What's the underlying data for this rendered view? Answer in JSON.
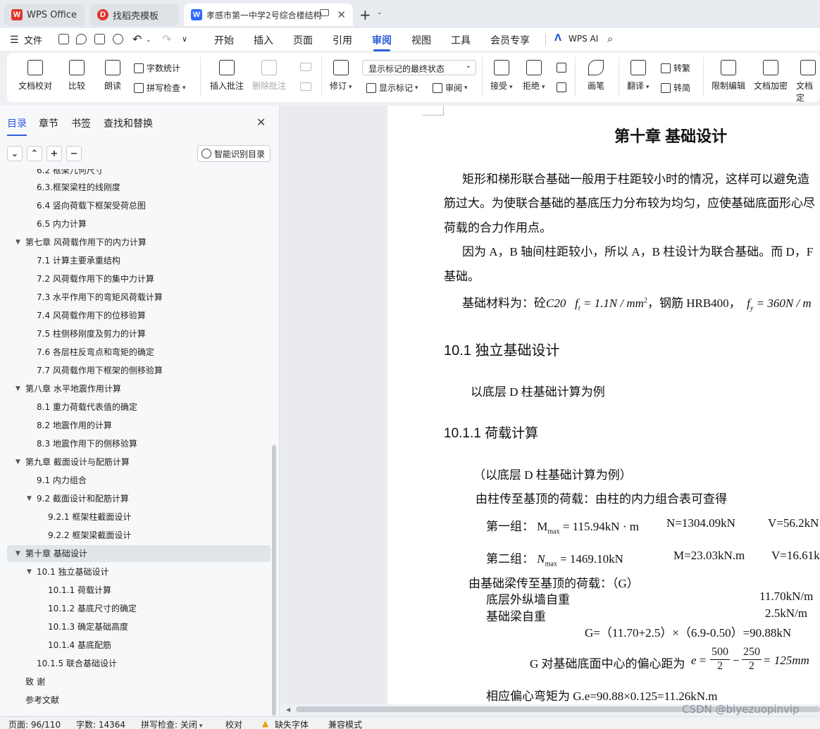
{
  "tabs": [
    {
      "label": "WPS Office",
      "icon": "wps-logo-icon"
    },
    {
      "label": "找稻壳模板",
      "icon": "docer-icon"
    },
    {
      "label": "孝感市第一中学2号综合楼结构",
      "icon": "writer-doc-icon"
    }
  ],
  "menu": {
    "file": "文件",
    "items": [
      "开始",
      "插入",
      "页面",
      "引用",
      "审阅",
      "视图",
      "工具",
      "会员专享"
    ],
    "selected": "审阅",
    "ai": "WPS AI"
  },
  "ribbon": {
    "doc_check": "文档校对",
    "compare": "比较",
    "read_aloud": "朗读",
    "word_count": "字数统计",
    "spell_check": "拼写检查",
    "insert_comment": "插入批注",
    "delete_comment": "删除批注",
    "revise": "修订",
    "markup_state": "显示标记的最终状态",
    "show_markup": "显示标记",
    "review_pane": "审阅",
    "accept": "接受",
    "reject": "拒绝",
    "pen": "画笔",
    "translate": "翻译",
    "to_traditional": "转繁",
    "to_simplified": "转简",
    "restrict_edit": "限制编辑",
    "encrypt": "文档加密",
    "doc_final": "文档定"
  },
  "panel": {
    "tabs": [
      "目录",
      "章节",
      "书签",
      "查找和替换"
    ],
    "smart_toc": "智能识别目录",
    "toc": [
      {
        "label": "6.2 框架几何尺寸",
        "level": 2
      },
      {
        "label": "6.3.框架梁柱的线刚度",
        "level": 2
      },
      {
        "label": "6.4 竖向荷载下框架受荷总图",
        "level": 2
      },
      {
        "label": "6.5 内力计算",
        "level": 2
      },
      {
        "label": "第七章  风荷载作用下的内力计算",
        "level": 1,
        "expanded": true
      },
      {
        "label": "7.1 计算主要承重结构",
        "level": 2
      },
      {
        "label": "7.2 风荷载作用下的集中力计算",
        "level": 2
      },
      {
        "label": "7.3 水平作用下的弯矩风荷载计算",
        "level": 2
      },
      {
        "label": "7.4  风荷载作用下的位移验算",
        "level": 2
      },
      {
        "label": "7.5  柱侧移刚度及剪力的计算",
        "level": 2
      },
      {
        "label": "7.6 各层柱反弯点和弯矩的确定",
        "level": 2
      },
      {
        "label": "7.7 风荷载作用下框架的侧移验算",
        "level": 2
      },
      {
        "label": "第八章  水平地震作用计算",
        "level": 1,
        "expanded": true
      },
      {
        "label": "8.1  重力荷载代表值的确定",
        "level": 2
      },
      {
        "label": "8.2  地震作用的计算",
        "level": 2
      },
      {
        "label": "8.3 地震作用下的侧移验算",
        "level": 2
      },
      {
        "label": "第九章  截面设计与配筋计算",
        "level": 1,
        "expanded": true
      },
      {
        "label": "9.1  内力组合",
        "level": 2
      },
      {
        "label": "9.2 截面设计和配筋计算",
        "level": 2,
        "expanded": true
      },
      {
        "label": "9.2.1 框架柱截面设计",
        "level": 3
      },
      {
        "label": "9.2.2 框架梁截面设计",
        "level": 3
      },
      {
        "label": "第十章  基础设计",
        "level": 1,
        "expanded": true,
        "selected": true
      },
      {
        "label": "10.1  独立基础设计",
        "level": 2,
        "expanded": true
      },
      {
        "label": "10.1.1 荷载计算",
        "level": 3
      },
      {
        "label": "10.1.2 基底尺寸的确定",
        "level": 3
      },
      {
        "label": "10.1.3 确定基础高度",
        "level": 3
      },
      {
        "label": "10.1.4 基底配筋",
        "level": 3
      },
      {
        "label": "10.1.5 联合基础设计",
        "level": 2
      },
      {
        "label": "致    谢",
        "level": 1
      },
      {
        "label": "参考文献",
        "level": 1
      }
    ]
  },
  "doc": {
    "chapter_title": "第十章  基础设计",
    "p1_l1": "矩形和梯形联合基础一般用于柱距较小时的情况，这样可以避免造",
    "p1_l2": "筋过大。为使联合基础的基底压力分布较为均匀，应使基础底面形心尽",
    "p1_l3": "荷载的合力作用点。",
    "p2_l1": "因为 A，B 轴间柱距较小，所以 A，B 柱设计为联合基础。而 D，F",
    "p2_l2": "基础。",
    "p3_prefix": "基础材料为：砼",
    "p3_concrete": "C20",
    "p3_ft": "f",
    "p3_ft_sub": "t",
    "p3_ft_val": " = 1.1N / mm",
    "p3_ft_sup": "2",
    "p3_steel": "，钢筋 HRB400，",
    "p3_fy": "f",
    "p3_fy_sub": "y",
    "p3_fy_val": " = 360N / m",
    "s101": "10.1  独立基础设计",
    "s101_text": "以底层 D 柱基础计算为例",
    "s1011": "10.1.1 荷载计算",
    "s1011_p1": "（以底层 D 柱基础计算为例）",
    "s1011_p2": "由柱传至基顶的荷载：由柱的内力组合表可查得",
    "g1_label": "第一组：",
    "g1_m": "M",
    "g1_m_sub": "max",
    "g1_m_val": " = 115.94kN · m",
    "g1_n": "N=1304.09kN",
    "g1_v": "V=56.2kN",
    "g2_label": "第二组：",
    "g2_n": "N",
    "g2_n_sub": "max",
    "g2_n_val": " = 1469.10kN",
    "g2_m": "M=23.03kN.m",
    "g2_v": "V=16.61k",
    "beam_load": "由基础梁传至基顶的荷载：（G）",
    "wall_label": "底层外纵墙自重",
    "wall_val": "11.70kN/m",
    "beam_label": "基础梁自重",
    "beam_val": "2.5kN/m",
    "g_formula": "G=（11.70+2.5）×（6.9-0.50）=90.88kN",
    "ecc_prefix": "G 对基础底面中心的偏心距为",
    "ecc_e": "e",
    "ecc_f1_num": "500",
    "ecc_f1_den": "2",
    "ecc_f2_num": "250",
    "ecc_f2_den": "2",
    "ecc_result": "= 125mm",
    "moment": "相应偏心弯矩为 G.e=90.88×0.125=11.26kN.m"
  },
  "status": {
    "page": "页面: 96/110",
    "words": "字数: 14364",
    "spell": "拼写检查: 关闭",
    "proof": "校对",
    "missing_font": "缺失字体",
    "compat": "兼容模式",
    "watermark": "CSDN @biyezuopinvip"
  },
  "colors": {
    "accent": "#2b5fd9",
    "wps_red": "#e0352b",
    "writer_blue": "#2f6bff"
  }
}
